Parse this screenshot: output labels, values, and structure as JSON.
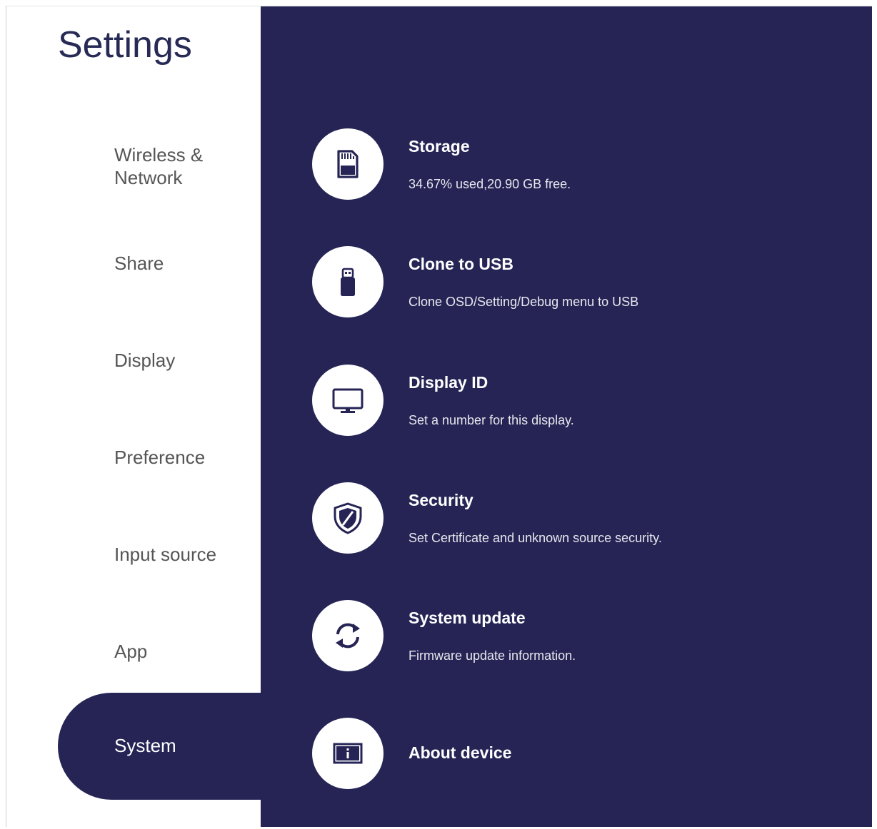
{
  "sidebar": {
    "title": "Settings",
    "items": [
      {
        "label": "Wireless &\nNetwork"
      },
      {
        "label": "Share"
      },
      {
        "label": "Display"
      },
      {
        "label": "Preference"
      },
      {
        "label": "Input source"
      },
      {
        "label": "App"
      },
      {
        "label": "System",
        "active": true
      }
    ]
  },
  "main": {
    "rows": [
      {
        "title": "Storage",
        "subtitle": "34.67% used,20.90 GB free.",
        "icon": "sd-card-icon"
      },
      {
        "title": "Clone to USB",
        "subtitle": "Clone OSD/Setting/Debug menu to USB",
        "icon": "usb-drive-icon"
      },
      {
        "title": "Display ID",
        "subtitle": "Set a number for this display.",
        "icon": "monitor-icon"
      },
      {
        "title": "Security",
        "subtitle": "Set Certificate and unknown source security.",
        "icon": "shield-icon"
      },
      {
        "title": "System update",
        "subtitle": "Firmware update information.",
        "icon": "sync-icon"
      },
      {
        "title": "About device",
        "icon": "info-icon"
      }
    ]
  },
  "colors": {
    "panel": "#252455",
    "title": "#262a55",
    "nav_text": "#555555"
  }
}
